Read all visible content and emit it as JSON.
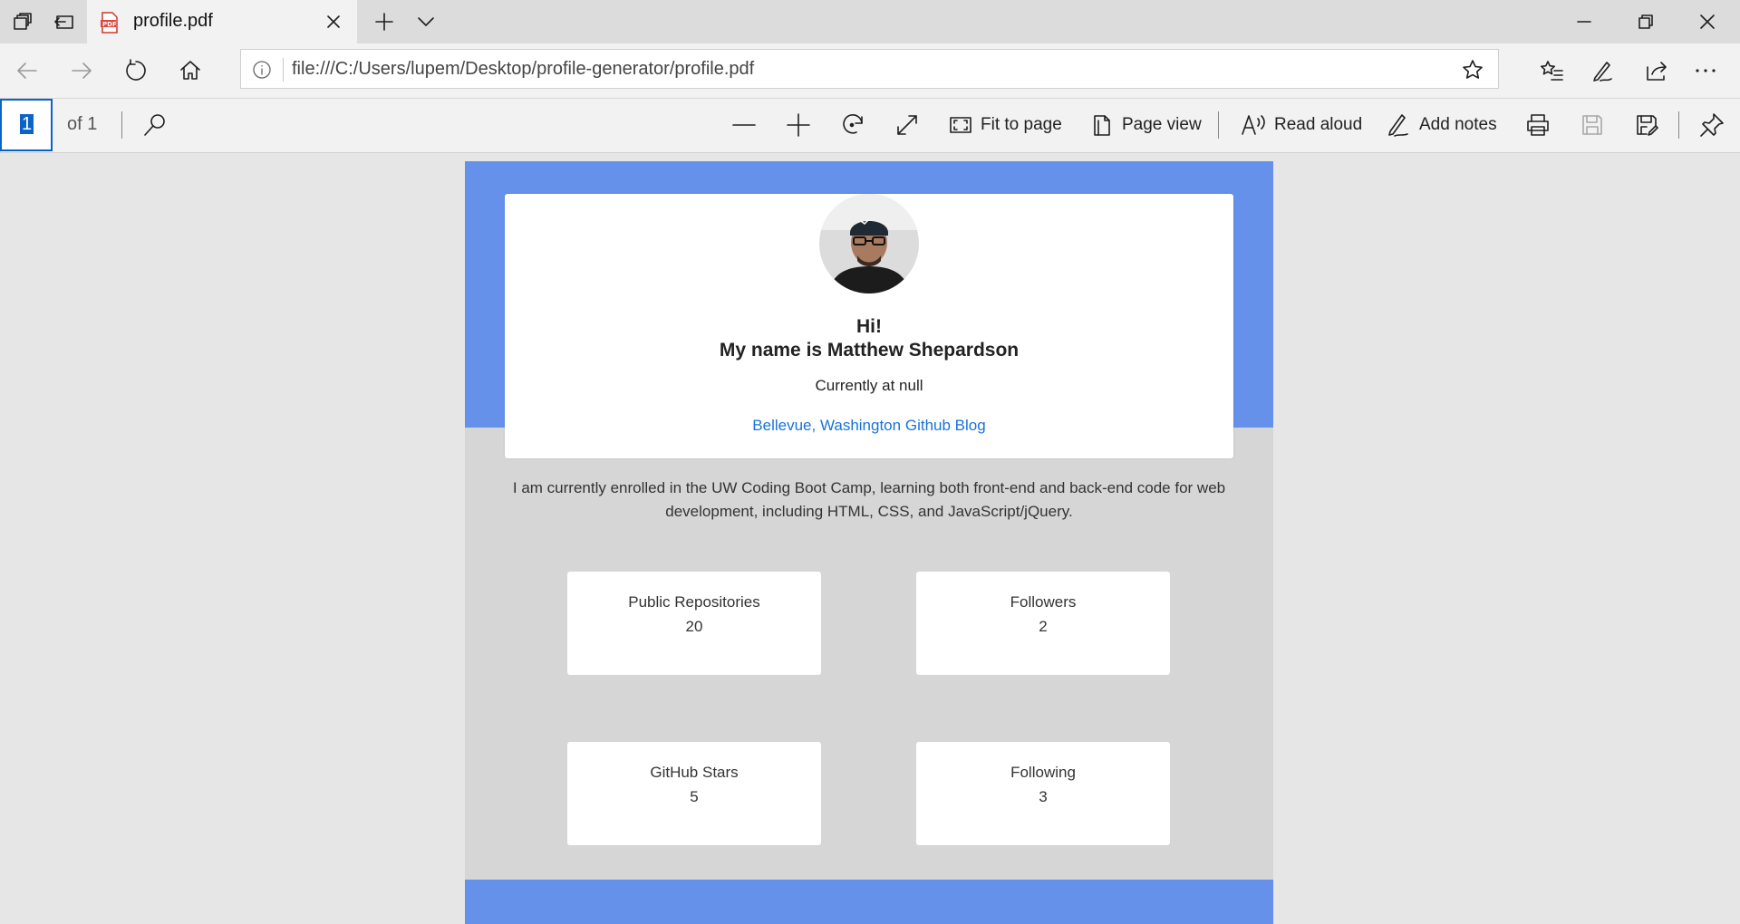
{
  "browser": {
    "tab_title": "profile.pdf",
    "address_url": "file:///C:/Users/lupem/Desktop/profile-generator/profile.pdf"
  },
  "pdf_toolbar": {
    "page_current": "1",
    "page_total_label": "of 1",
    "fit_label": "Fit to page",
    "page_view_label": "Page view",
    "read_aloud_label": "Read aloud",
    "add_notes_label": "Add notes"
  },
  "profile": {
    "greeting": "Hi!",
    "name_line": "My name is Matthew Shepardson",
    "company_line": "Currently at null",
    "location_link": "Bellevue, Washington",
    "github_link": "Github",
    "blog_link": "Blog",
    "bio": "I am currently enrolled in the UW Coding Boot Camp, learning both front-end and back-end code for web development, including HTML, CSS, and JavaScript/jQuery.",
    "stats": [
      {
        "label": "Public Repositories",
        "value": "20"
      },
      {
        "label": "Followers",
        "value": "2"
      },
      {
        "label": "GitHub Stars",
        "value": "5"
      },
      {
        "label": "Following",
        "value": "3"
      }
    ]
  },
  "colors": {
    "accent_blue": "#6591eb",
    "link_blue": "#1a73d9",
    "page_grey": "#d6d6d6"
  }
}
